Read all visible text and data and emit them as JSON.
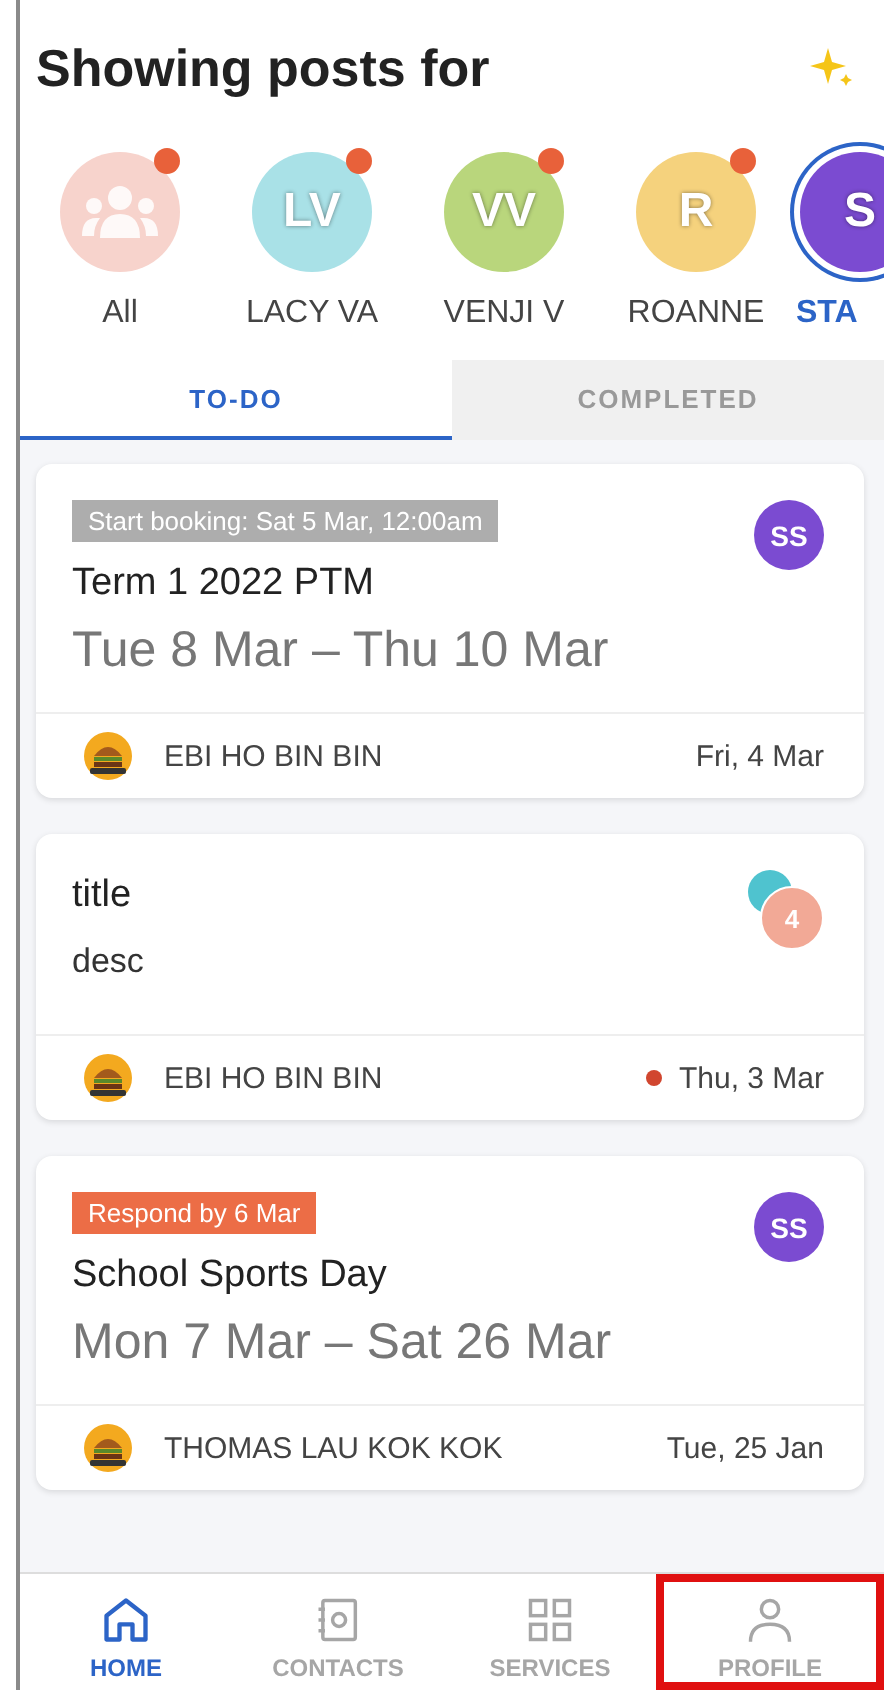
{
  "header": {
    "title": "Showing posts for"
  },
  "profiles": [
    {
      "kind": "group",
      "label": "All",
      "color": "#f7d3cc",
      "dot": true,
      "selected": false
    },
    {
      "kind": "initials",
      "initials": "LV",
      "label": "LACY VA",
      "color": "#a9e1e7",
      "dot": true,
      "selected": false
    },
    {
      "kind": "initials",
      "initials": "VV",
      "label": "VENJI V",
      "color": "#b9d67c",
      "dot": true,
      "selected": false
    },
    {
      "kind": "initials",
      "initials": "R",
      "label": "ROANNE",
      "color": "#f5d27d",
      "dot": true,
      "selected": false
    },
    {
      "kind": "initials",
      "initials": "S",
      "label": "STA",
      "color": "#7b4bd1",
      "dot": false,
      "selected": true
    }
  ],
  "tabs": [
    {
      "label": "TO-DO",
      "selected": true
    },
    {
      "label": "COMPLETED",
      "selected": false
    }
  ],
  "posts": [
    {
      "badge": {
        "kind": "info",
        "text": "Start booking: Sat 5 Mar, 12:00am"
      },
      "title": "Term 1 2022 PTM",
      "subtitle": "Tue 8 Mar – Thu 10 Mar",
      "avatar": {
        "kind": "single",
        "initials": "SS"
      },
      "sender": "EBI HO BIN BIN",
      "date": "Fri, 4 Mar",
      "unread": false
    },
    {
      "title": "title",
      "description": "desc",
      "avatar": {
        "kind": "stack",
        "count": "4"
      },
      "sender": "EBI HO BIN BIN",
      "date": "Thu, 3 Mar",
      "unread": true
    },
    {
      "badge": {
        "kind": "urgent",
        "text": "Respond by 6 Mar"
      },
      "title": "School Sports Day",
      "subtitle": "Mon 7 Mar – Sat 26 Mar",
      "avatar": {
        "kind": "single",
        "initials": "SS"
      },
      "sender": "THOMAS LAU KOK KOK",
      "date": "Tue, 25 Jan",
      "unread": false
    }
  ],
  "nav": [
    {
      "kind": "home",
      "label": "HOME",
      "selected": true,
      "highlighted": false
    },
    {
      "kind": "contacts",
      "label": "CONTACTS",
      "selected": false,
      "highlighted": false
    },
    {
      "kind": "services",
      "label": "SERVICES",
      "selected": false,
      "highlighted": false
    },
    {
      "kind": "profile",
      "label": "PROFILE",
      "selected": false,
      "highlighted": true
    }
  ]
}
